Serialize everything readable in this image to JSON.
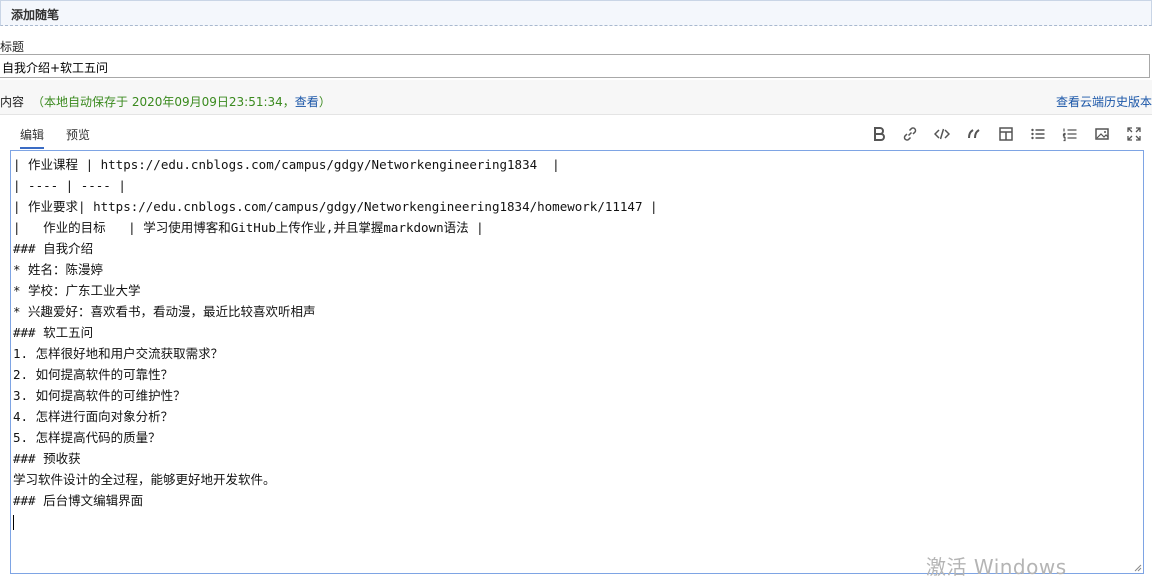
{
  "header": {
    "title": "添加随笔"
  },
  "title_field": {
    "label": "标题",
    "value": "自我介绍+软工五问"
  },
  "content_field": {
    "label": "内容",
    "autosave_prefix": "（本地自动保存于 2020年09月09日23:51:34，",
    "autosave_link": "查看",
    "autosave_suffix": "）",
    "cloud_history": "查看云端历史版本"
  },
  "tabs": [
    {
      "label": "编辑",
      "active": true
    },
    {
      "label": "预览",
      "active": false
    }
  ],
  "toolbar": {
    "icons": [
      "bold-icon",
      "link-icon",
      "code-icon",
      "quote-icon",
      "table-icon",
      "unordered-list-icon",
      "ordered-list-icon",
      "image-icon",
      "fullscreen-icon"
    ]
  },
  "editor": {
    "lines": [
      "| 作业课程 | https://edu.cnblogs.com/campus/gdgy/Networkengineering1834  |",
      "| ---- | ---- |",
      "| 作业要求| https://edu.cnblogs.com/campus/gdgy/Networkengineering1834/homework/11147 |",
      "|   作业的目标   | 学习使用博客和GitHub上传作业,并且掌握markdown语法 |",
      "### 自我介绍",
      "* 姓名：陈漫婷",
      "* 学校：广东工业大学",
      "* 兴趣爱好：喜欢看书，看动漫，最近比较喜欢听相声",
      "### 软工五问",
      "1. 怎样很好地和用户交流获取需求？",
      "2. 如何提高软件的可靠性？",
      "3. 如何提高软件的可维护性？",
      "4. 怎样进行面向对象分析？",
      "5. 怎样提高代码的质量？",
      "### 预收获",
      "学习软件设计的全过程，能够更好地开发软件。",
      "### 后台博文编辑界面",
      ""
    ]
  },
  "watermark": "激活 Windows"
}
